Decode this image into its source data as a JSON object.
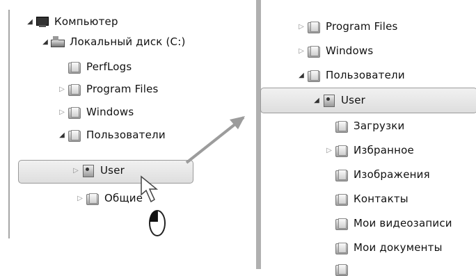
{
  "left_tree": {
    "items": [
      {
        "label": "Компьютер",
        "icon": "computer-icon",
        "arrow": "expanded"
      },
      {
        "label": "Локальный диск (C:)",
        "icon": "drive-icon",
        "arrow": "expanded"
      },
      {
        "label": "PerfLogs",
        "icon": "folder-icon",
        "arrow": "none"
      },
      {
        "label": "Program Files",
        "icon": "folder-icon",
        "arrow": "collapsed"
      },
      {
        "label": "Windows",
        "icon": "folder-icon",
        "arrow": "collapsed"
      },
      {
        "label": "Пользователи",
        "icon": "folder-icon",
        "arrow": "expanded"
      },
      {
        "label": "User",
        "icon": "user-folder-icon",
        "arrow": "collapsed",
        "selected": true
      },
      {
        "label": "Общие",
        "icon": "folder-icon",
        "arrow": "collapsed"
      }
    ]
  },
  "right_tree": {
    "items": [
      {
        "label": "Program Files",
        "icon": "folder-icon",
        "arrow": "collapsed"
      },
      {
        "label": "Windows",
        "icon": "folder-icon",
        "arrow": "collapsed"
      },
      {
        "label": "Пользователи",
        "icon": "folder-icon",
        "arrow": "expanded"
      },
      {
        "label": "User",
        "icon": "user-folder-icon",
        "arrow": "expanded",
        "selected": true
      },
      {
        "label": "Загрузки",
        "icon": "downloads-folder-icon",
        "arrow": "none"
      },
      {
        "label": "Избранное",
        "icon": "favorites-folder-icon",
        "arrow": "collapsed"
      },
      {
        "label": "Изображения",
        "icon": "pictures-folder-icon",
        "arrow": "none"
      },
      {
        "label": "Контакты",
        "icon": "contacts-folder-icon",
        "arrow": "none"
      },
      {
        "label": "Мои видеозаписи",
        "icon": "videos-folder-icon",
        "arrow": "none"
      },
      {
        "label": "Мои документы",
        "icon": "documents-folder-icon",
        "arrow": "none"
      }
    ]
  }
}
